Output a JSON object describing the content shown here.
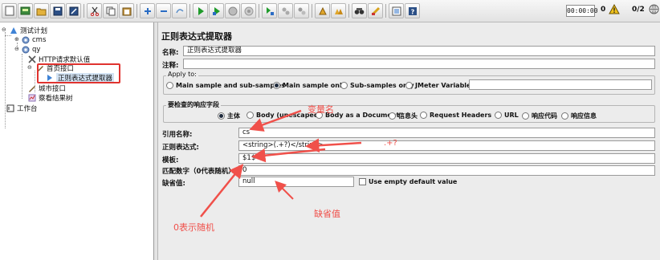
{
  "toolbar": {
    "icons": [
      "new-icon",
      "templates-icon",
      "open-icon",
      "save-icon",
      "save-as-icon",
      "cut-icon",
      "copy-icon",
      "paste-icon",
      "expand-icon",
      "collapse-icon",
      "toggle-icon",
      "start-icon",
      "start-no-pause-icon",
      "stop-icon",
      "shutdown-icon",
      "remote-start-icon",
      "remote-stop-icon",
      "remote-exit-icon",
      "clear-icon",
      "clear-all-icon",
      "search-icon",
      "reset-search-icon",
      "function-helper-icon",
      "help-icon"
    ],
    "timer": "00:00:00",
    "warnings": "0",
    "threads": "0/2"
  },
  "tree": {
    "test_plan": "测试计划",
    "cms": "cms",
    "qy": "qy",
    "http_defaults": "HTTP请求默认值",
    "homepage": "首页接口",
    "regex_extractor": "正则表达式提取器",
    "city_api": "城市接口",
    "results_tree": "察看结果树",
    "workbench": "工作台"
  },
  "panel": {
    "title": "正则表达式提取器",
    "name_label": "名称:",
    "name_value": "正则表达式提取器",
    "comment_label": "注释:",
    "comment_value": "",
    "apply_to": {
      "title": "Apply to:",
      "options": [
        "Main sample and sub-samples",
        "Main sample only",
        "Sub-samples only",
        "JMeter Variable"
      ],
      "selected": "Main sample only",
      "variable_value": ""
    },
    "field_to_check": {
      "title": "要检查的响应字段",
      "options": [
        "主体",
        "Body (unescaped)",
        "Body as a Document",
        "信息头",
        "Request Headers",
        "URL",
        "响应代码",
        "响应信息"
      ],
      "selected": "主体"
    },
    "ref_name_label": "引用名称:",
    "ref_name_value": "cs",
    "regex_label": "正则表达式:",
    "regex_value": "<string>(.+?)</string>",
    "template_label": "模板:",
    "template_value": "$1$",
    "match_no_label": "匹配数字（0代表随机）:",
    "match_no_value": "0",
    "default_label": "缺省值:",
    "default_value": "null",
    "use_empty_default": "Use empty default value"
  },
  "annotations": {
    "var_name": "变量名",
    "regex_hint": ".+?",
    "random_hint": "0表示随机",
    "default_hint": "缺省值"
  },
  "colors": {
    "annotation": "#f0504a",
    "highlight_box": "#e0332f",
    "selected_node": "#d3e3f4"
  }
}
